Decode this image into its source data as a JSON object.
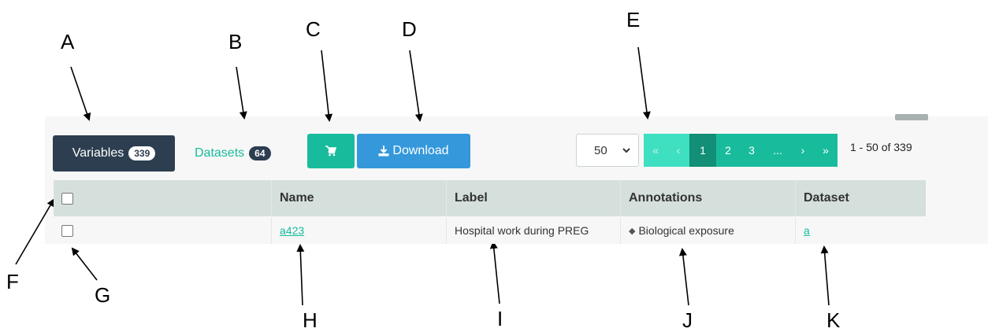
{
  "annotations": {
    "a": "A",
    "b": "B",
    "c": "C",
    "d": "D",
    "e": "E",
    "f": "F",
    "g": "G",
    "h": "H",
    "i": "I",
    "j": "J",
    "k": "K"
  },
  "tabs": {
    "variables": {
      "label": "Variables",
      "count": "339"
    },
    "datasets": {
      "label": "Datasets",
      "count": "64"
    }
  },
  "toolbar": {
    "cart_icon": "cart-icon",
    "download_label": "Download",
    "download_icon": "download-icon"
  },
  "page_size": {
    "selected": "50"
  },
  "pagination": {
    "first": "«",
    "prev": "‹",
    "pages": [
      "1",
      "2",
      "3"
    ],
    "ellipsis": "...",
    "next": "›",
    "last": "»",
    "active_page": "1"
  },
  "range_text": "1 - 50 of 339",
  "table": {
    "columns": [
      "",
      "Name",
      "Label",
      "Annotations",
      "Dataset"
    ],
    "rows": [
      {
        "name": "a423",
        "label": "Hospital work during PREG",
        "annotation": "Biological exposure",
        "dataset": "a"
      }
    ]
  },
  "colors": {
    "primary_dark": "#2c3e50",
    "accent_green": "#18bc9c",
    "accent_blue": "#3498db",
    "header_bg": "#d5e0dd"
  }
}
